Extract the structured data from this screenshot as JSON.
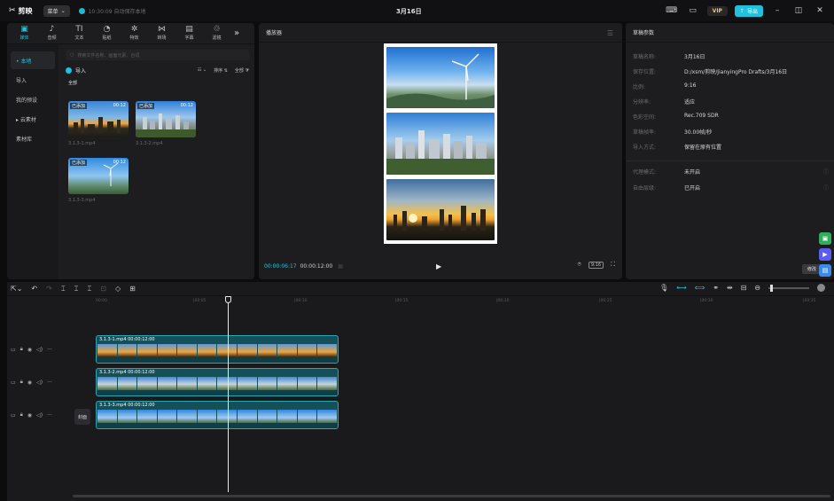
{
  "app": {
    "name": "剪映",
    "menu_label": "菜单",
    "save_status": "10:30:09 自动保存本地",
    "doc_title": "3月16日",
    "vip_label": "VIP",
    "export_label": "导出"
  },
  "media": {
    "tabs": [
      {
        "label": "媒体",
        "icon": "media-icon"
      },
      {
        "label": "音频",
        "icon": "audio-icon"
      },
      {
        "label": "文本",
        "icon": "text-icon"
      },
      {
        "label": "贴纸",
        "icon": "sticker-icon"
      },
      {
        "label": "特效",
        "icon": "effects-icon"
      },
      {
        "label": "转场",
        "icon": "transition-icon"
      },
      {
        "label": "字幕",
        "icon": "subtitle-icon"
      },
      {
        "label": "滤镜",
        "icon": "filter-icon"
      }
    ],
    "sidebar": [
      "• 本地",
      "导入",
      "我的预设",
      "▸ 云素材",
      "素材库"
    ],
    "search_placeholder": "搜索文件名称、画面元素、台词",
    "import_label": "导入",
    "sort_label": "排序",
    "filter_label": "全部",
    "section_label": "全部",
    "clips": [
      {
        "tag": "已添加",
        "duration": "00:12",
        "name": "3.1.3-1.mp4"
      },
      {
        "tag": "已添加",
        "duration": "00:12",
        "name": "3.1.3-2.mp4"
      },
      {
        "tag": "已添加",
        "duration": "00:12",
        "name": "3.1.3-3.mp4"
      }
    ]
  },
  "player": {
    "title": "播放器",
    "time_current": "00:00:06:17",
    "time_total": "00:00:12:00",
    "ratio_label": "9:16"
  },
  "props": {
    "title": "草稿参数",
    "rows": [
      {
        "key": "草稿名称:",
        "value": "3月16日"
      },
      {
        "key": "保存位置:",
        "value": "D:/xsm/剪映/JianyingPro Drafts/3月16日"
      },
      {
        "key": "比例:",
        "value": "9:16"
      },
      {
        "key": "分辨率:",
        "value": "适应"
      },
      {
        "key": "色彩空间:",
        "value": "Rec.709 SDR"
      },
      {
        "key": "草稿帧率:",
        "value": "30.00帧/秒"
      },
      {
        "key": "导入方式:",
        "value": "保留在原有位置"
      }
    ],
    "rows2": [
      {
        "key": "代理模式:",
        "value": "未开启"
      },
      {
        "key": "自由层级:",
        "value": "已开启"
      }
    ],
    "edit_label": "修改"
  },
  "timeline": {
    "ruler": [
      "00:00",
      "|00:05",
      "|00:10",
      "|00:15",
      "|00:20",
      "|00:25",
      "|00:30",
      "|00:35"
    ],
    "cover_label": "封面",
    "tracks": [
      {
        "label": "3.1.3-1.mp4  00:00:12:00"
      },
      {
        "label": "3.1.3-2.mp4  00:00:12:00"
      },
      {
        "label": "3.1.3-3.mp4  00:00:12:00"
      }
    ]
  },
  "colors": {
    "accent": "#1fc1de",
    "track_fill": "#154f57"
  }
}
